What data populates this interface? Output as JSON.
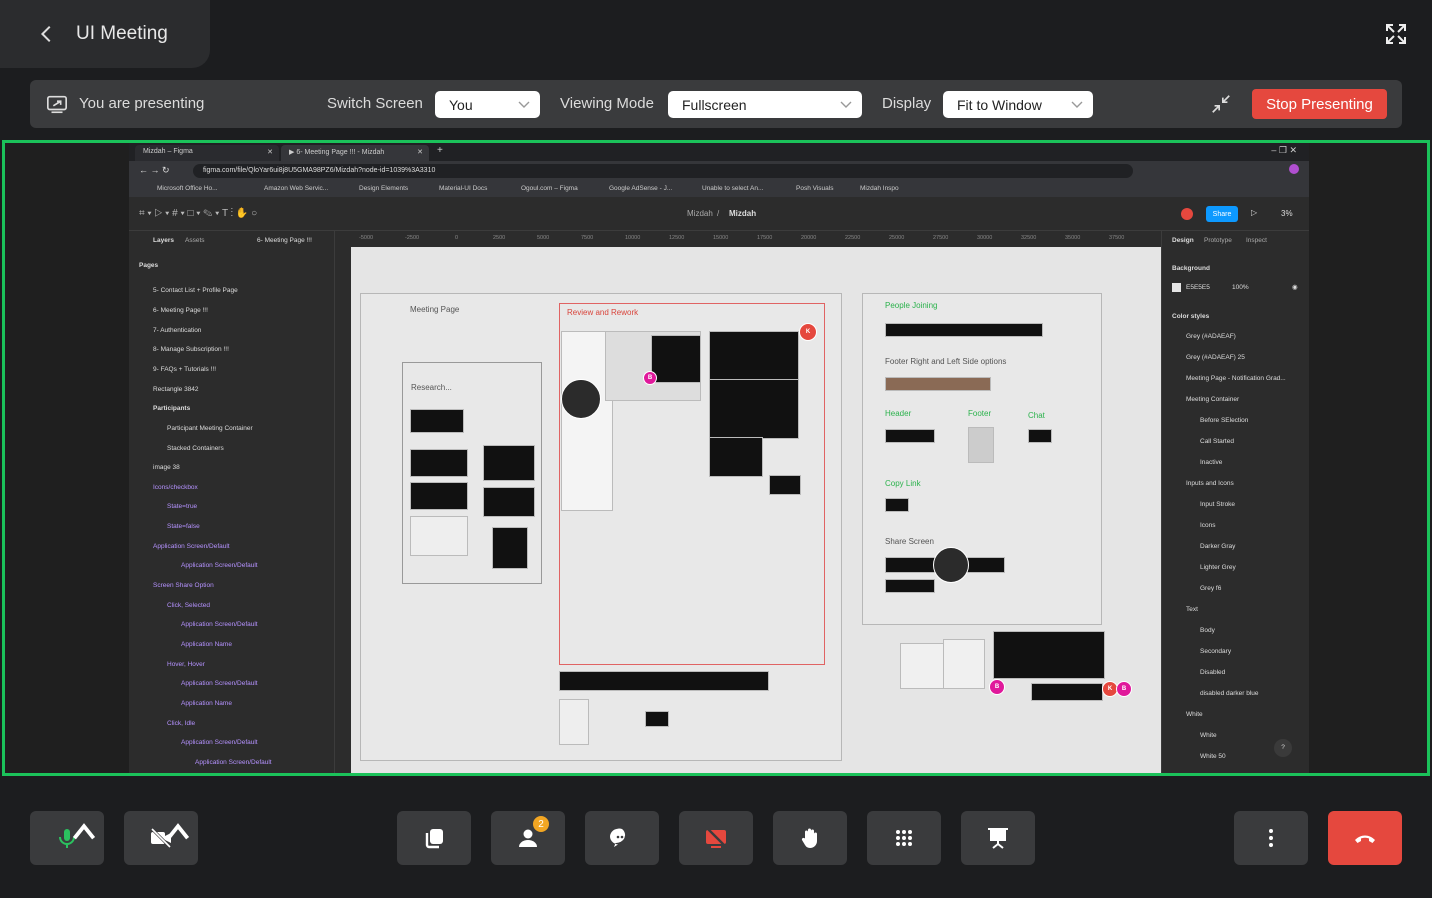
{
  "header": {
    "title": "UI Meeting"
  },
  "present_bar": {
    "status": "You are presenting",
    "switch_label": "Switch Screen",
    "switch_value": "You",
    "mode_label": "Viewing Mode",
    "mode_value": "Fullscreen",
    "display_label": "Display",
    "display_value": "Fit to Window",
    "stop_label": "Stop Presenting"
  },
  "shared": {
    "tabs": [
      "Mizdah – Figma",
      "▶ 6- Meeting Page !!! - Mizdah"
    ],
    "url": "figma.com/file/QloYar6ui8j8U5GMA98PZ6/Mizdah?node-id=1039%3A3310",
    "bookmarks": [
      "Microsoft Office Ho...",
      "Amazon Web Servic...",
      "Design Elements",
      "Material-UI Docs",
      "Ogoul.com – Figma",
      "Google AdSense - J...",
      "Unable to select An...",
      "Posh Visuals",
      "Mizdah Inspo"
    ],
    "file_path": "Mizdah",
    "file_name": "Mizdah",
    "share_label": "Share",
    "zoom": "3%",
    "ruler": [
      "-5000",
      "-2500",
      "0",
      "2500",
      "5000",
      "7500",
      "10000",
      "12500",
      "15000",
      "17500",
      "20000",
      "22500",
      "25000",
      "27500",
      "30000",
      "32500",
      "35000",
      "37500"
    ],
    "left_tabs": [
      "Layers",
      "Assets"
    ],
    "page_select": "6- Meeting Page !!!",
    "pages_title": "Pages",
    "pages": [
      "5- Contact List + Profile Page",
      "6- Meeting Page !!!",
      "7- Authentication",
      "8- Manage Subscription !!!",
      "9- FAQs + Tutorials !!!"
    ],
    "layers": [
      "Rectangle 3842",
      "Participants",
      "Participant Meeting Container",
      "Stacked Containers",
      "image 38",
      "Icons/checkbox",
      "State=true",
      "State=false",
      "Application Screen/Default",
      "Application Screen/Default",
      "Screen Share Option",
      "Click, Selected",
      "Application Screen/Default",
      "Application Name",
      "Hover, Hover",
      "Application Screen/Default",
      "Application Name",
      "Click, Idle",
      "Application Screen/Default",
      "Application Screen/Default"
    ],
    "right_tabs": [
      "Design",
      "Prototype",
      "Inspect"
    ],
    "background_title": "Background",
    "bg_hex": "E5E5E5",
    "bg_opacity": "100%",
    "color_styles_title": "Color styles",
    "styles": [
      "Grey (#ADAEAF)",
      "Grey (#ADAEAF) 25",
      "Meeting Page - Notification Grad...",
      "Meeting Container",
      "Before SElection",
      "Call Started",
      "Inactive",
      "Inputs and Icons",
      "Input Stroke",
      "Icons",
      "Darker Gray",
      "Lighter Grey",
      "Grey f6",
      "Text",
      "Body",
      "Secondary",
      "Disabled",
      "disabled darker blue",
      "White",
      "White",
      "White 50"
    ],
    "frames": {
      "meeting": "Meeting Page",
      "research": "Research...",
      "review": "Review and Rework",
      "joining": "People Joining",
      "footer_opts": "Footer Right and Left Side options",
      "header": "Header",
      "footer": "Footer",
      "chat": "Chat",
      "copy": "Copy Link",
      "share": "Share Screen"
    }
  },
  "colors": {
    "accent": "#1bc25a",
    "stop": "#e5483e",
    "badge": "#f2a623",
    "end_call": "#e5483e"
  },
  "tray": {
    "participants_badge": "2"
  }
}
